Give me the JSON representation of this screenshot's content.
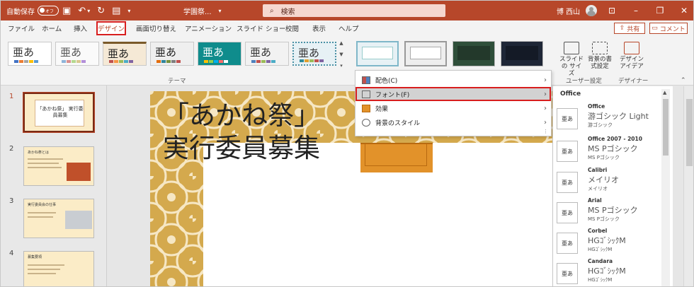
{
  "titlebar": {
    "autosave_label": "自動保存",
    "autosave_state": "オフ",
    "doc_title": "学園祭...",
    "title_caret": "▾",
    "search_placeholder": "検索",
    "user_name": "博 西山"
  },
  "tabs": [
    "ファイル",
    "ホーム",
    "挿入",
    "デザイン",
    "画面切り替え",
    "アニメーション",
    "スライド ショー",
    "校閲",
    "表示",
    "ヘルプ"
  ],
  "active_tab": "デザイン",
  "share_label": "共有",
  "comment_label": "コメント",
  "ribbon": {
    "theme_glyph": "亜あ",
    "theme_group_label": "テーマ",
    "slide_size_label": "スライドの サイズ",
    "bg_format_label": "背景の書 式設定",
    "user_settings_label": "ユーザー設定",
    "designer_label": "デザイン アイデア",
    "designer_group_label": "デザイナー"
  },
  "slides_panel": {
    "numbers": [
      "1",
      "2",
      "3",
      "4"
    ],
    "thumb1_text": "「あかね祭」 実行委員募集",
    "thumb2_title": "あかね祭とは",
    "thumb3_title": "実行委員会の仕事",
    "thumb4_title": "募集要項"
  },
  "slide": {
    "title_line1": "「あかね祭」",
    "title_line2": "実行委員募集"
  },
  "variants_menu": {
    "items": [
      {
        "label": "配色(C)"
      },
      {
        "label": "フォント(F)"
      },
      {
        "label": "効果"
      },
      {
        "label": "背景のスタイル"
      }
    ]
  },
  "font_panel": {
    "header": "Office",
    "icon_glyph": "亜あ",
    "items": [
      {
        "name": "Office",
        "major": "游ゴシック Light",
        "minor": "游ゴシック"
      },
      {
        "name": "Office 2007 - 2010",
        "major": "MS Pゴシック",
        "minor": "MS Pゴシック"
      },
      {
        "name": "Calibri",
        "major": "メイリオ",
        "minor": "メイリオ"
      },
      {
        "name": "Arial",
        "major": "MS Pゴシック",
        "minor": "MS Pゴシック"
      },
      {
        "name": "Corbel",
        "major": "HGｺﾞｼｯｸM",
        "minor": "HGｺﾞｼｯｸM"
      },
      {
        "name": "Candara",
        "major": "HGｺﾞｼｯｸM",
        "minor": "HGｺﾞｼｯｸM"
      }
    ]
  },
  "colors": {
    "accent": "#b7472a",
    "highlight_border": "#d81e1e",
    "slide_pattern": "#d4a94d",
    "slide_tab": "#e2922a"
  }
}
